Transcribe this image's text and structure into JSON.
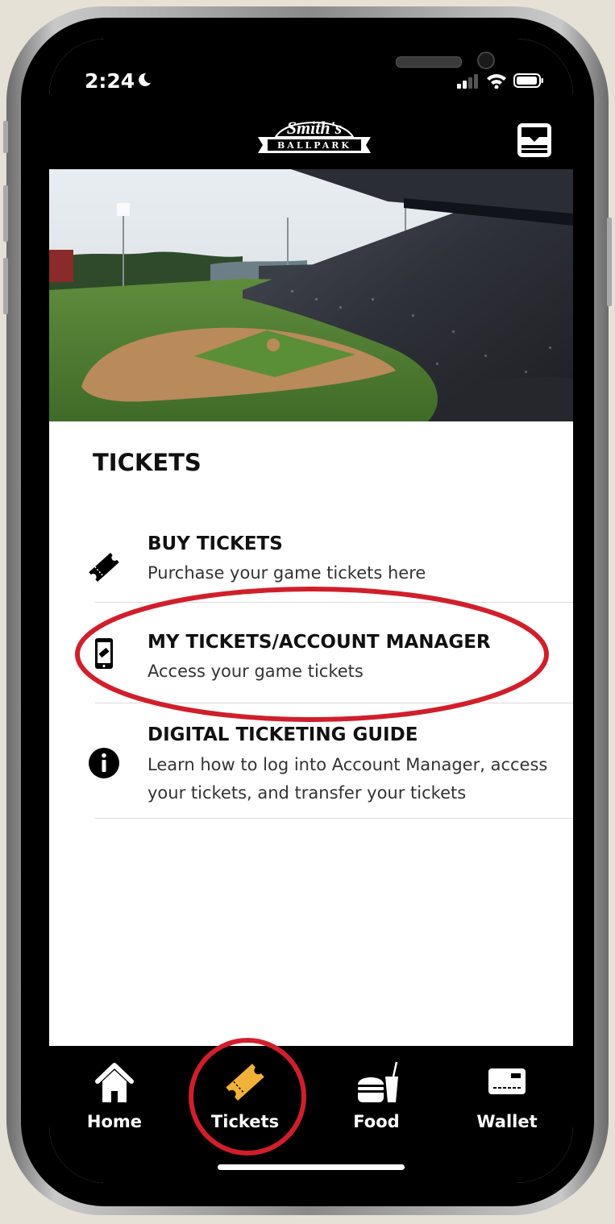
{
  "status_bar": {
    "time": "2:24"
  },
  "header": {
    "logo_main": "Smith's",
    "logo_sub": "BALLPARK"
  },
  "section_title": "TICKETS",
  "menu": [
    {
      "title": "BUY TICKETS",
      "subtitle": "Purchase your game tickets here",
      "icon": "ticket-icon"
    },
    {
      "title": "MY TICKETS/ACCOUNT MANAGER",
      "subtitle": "Access your game tickets",
      "icon": "phone-ticket-icon"
    },
    {
      "title": "DIGITAL TICKETING GUIDE",
      "subtitle": "Learn how to log into Account Manager, access your tickets, and transfer your tickets",
      "icon": "info-icon"
    }
  ],
  "tabs": [
    {
      "label": "Home",
      "icon": "home-icon",
      "active": false
    },
    {
      "label": "Tickets",
      "icon": "ticket-icon",
      "active": true
    },
    {
      "label": "Food",
      "icon": "burger-drink-icon",
      "active": false
    },
    {
      "label": "Wallet",
      "icon": "card-icon",
      "active": false
    }
  ],
  "colors": {
    "accent": "#f2b23a",
    "annotation": "#d01f2b",
    "bar": "#000000",
    "background": "#ffffff"
  }
}
